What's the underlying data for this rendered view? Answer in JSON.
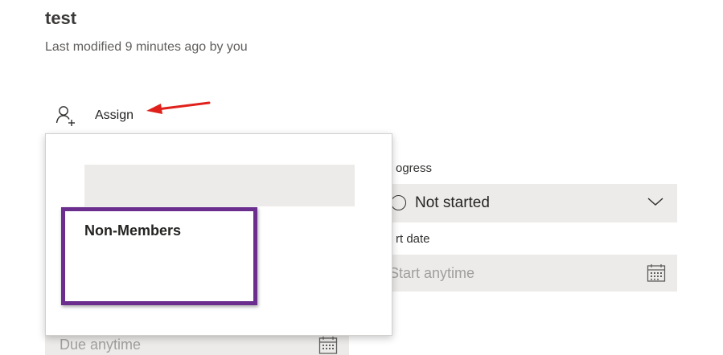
{
  "task": {
    "title": "test",
    "last_modified": "Last modified 9 minutes ago by you"
  },
  "assign": {
    "label": "Assign",
    "icon": "person-add-icon"
  },
  "progress": {
    "label": "ogress",
    "value": "Not started",
    "icon": "status-circle-icon"
  },
  "start_date": {
    "label": "rt date",
    "placeholder": "Start anytime",
    "icon": "calendar-icon"
  },
  "due_date": {
    "placeholder": "Due anytime",
    "icon": "calendar-icon"
  },
  "assign_popup": {
    "search_value": "",
    "section_heading": "Non-Members"
  },
  "annotations": {
    "arrow_color": "#e0201b",
    "highlight_color": "#6b2d8e"
  }
}
